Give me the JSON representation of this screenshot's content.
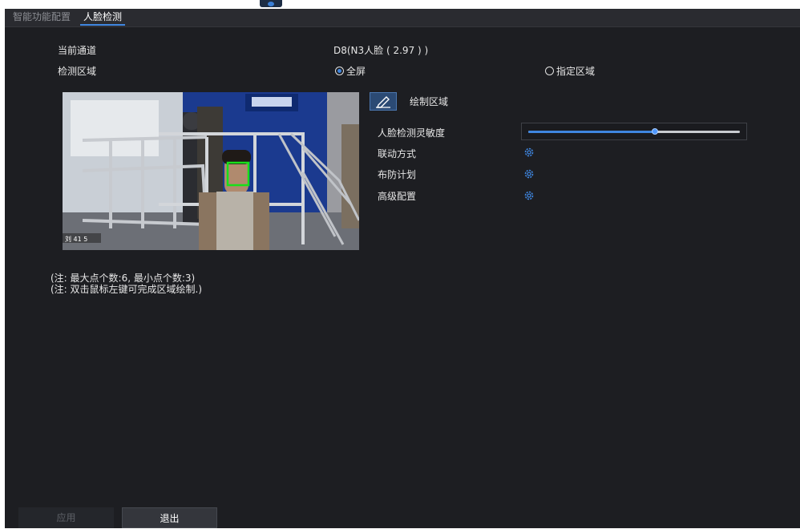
{
  "tabs": [
    {
      "label": "智能功能配置",
      "active": false
    },
    {
      "label": "人脸检测",
      "active": true
    }
  ],
  "channel": {
    "label": "当前通道",
    "value": "D8(N3人脸 ( 2.97 ) )"
  },
  "detection_area": {
    "label": "检测区域",
    "options": [
      {
        "label": "全屏",
        "selected": true
      },
      {
        "label": "指定区域",
        "selected": false
      }
    ]
  },
  "draw_area": {
    "label": "绘制区域",
    "icon": "pencil-icon"
  },
  "video": {
    "overlay_text": "刘 41 5"
  },
  "settings": {
    "sensitivity": {
      "label": "人脸检测灵敏度",
      "value_fraction": 0.6
    },
    "linkage": {
      "label": "联动方式",
      "icon": "gear-icon"
    },
    "schedule": {
      "label": "布防计划",
      "icon": "gear-icon"
    },
    "advanced": {
      "label": "高级配置",
      "icon": "gear-icon"
    }
  },
  "notes": [
    "(注: 最大点个数:6, 最小点个数:3)",
    "(注: 双击鼠标左键可完成区域绘制.)"
  ],
  "buttons": {
    "apply": "应用",
    "exit": "退出"
  },
  "colors": {
    "accent": "#3f86e0",
    "background": "#1d1e22",
    "face_box": "#18e01a"
  }
}
